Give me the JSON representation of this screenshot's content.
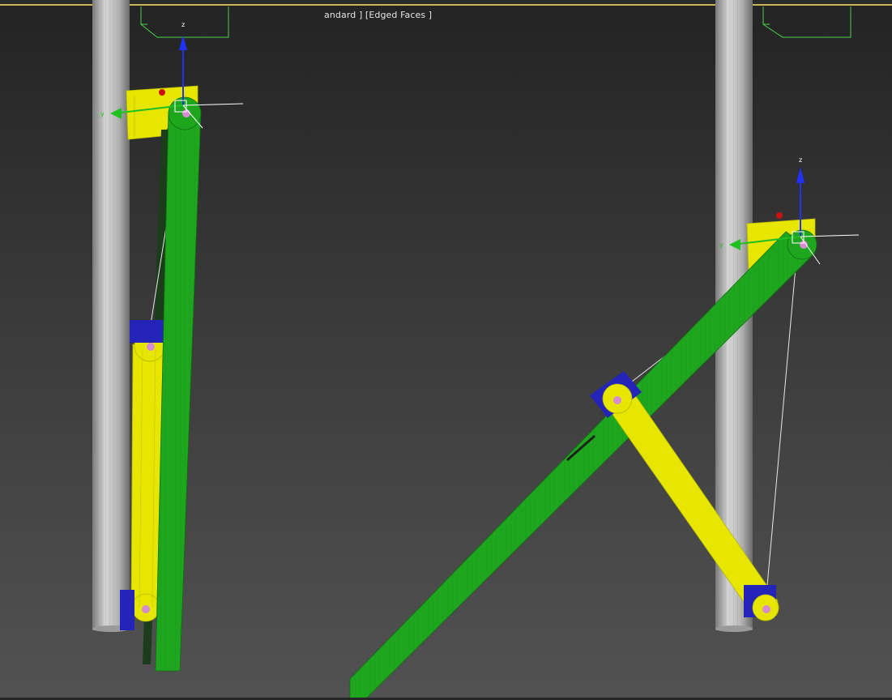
{
  "viewport": {
    "label": "andard ] [Edged Faces ]"
  },
  "gizmo_left": {
    "z": "z",
    "y": "y"
  },
  "gizmo_right": {
    "z": "z",
    "y": "y"
  },
  "colors": {
    "green_beam": "#1fa61f",
    "yellow_arm": "#e6e600",
    "blue_bracket": "#2424b8",
    "pivot": "#d88bd0",
    "pole": "#b0b0b0",
    "wire_box": "#4bd04b",
    "active_border": "#c9b45a"
  }
}
